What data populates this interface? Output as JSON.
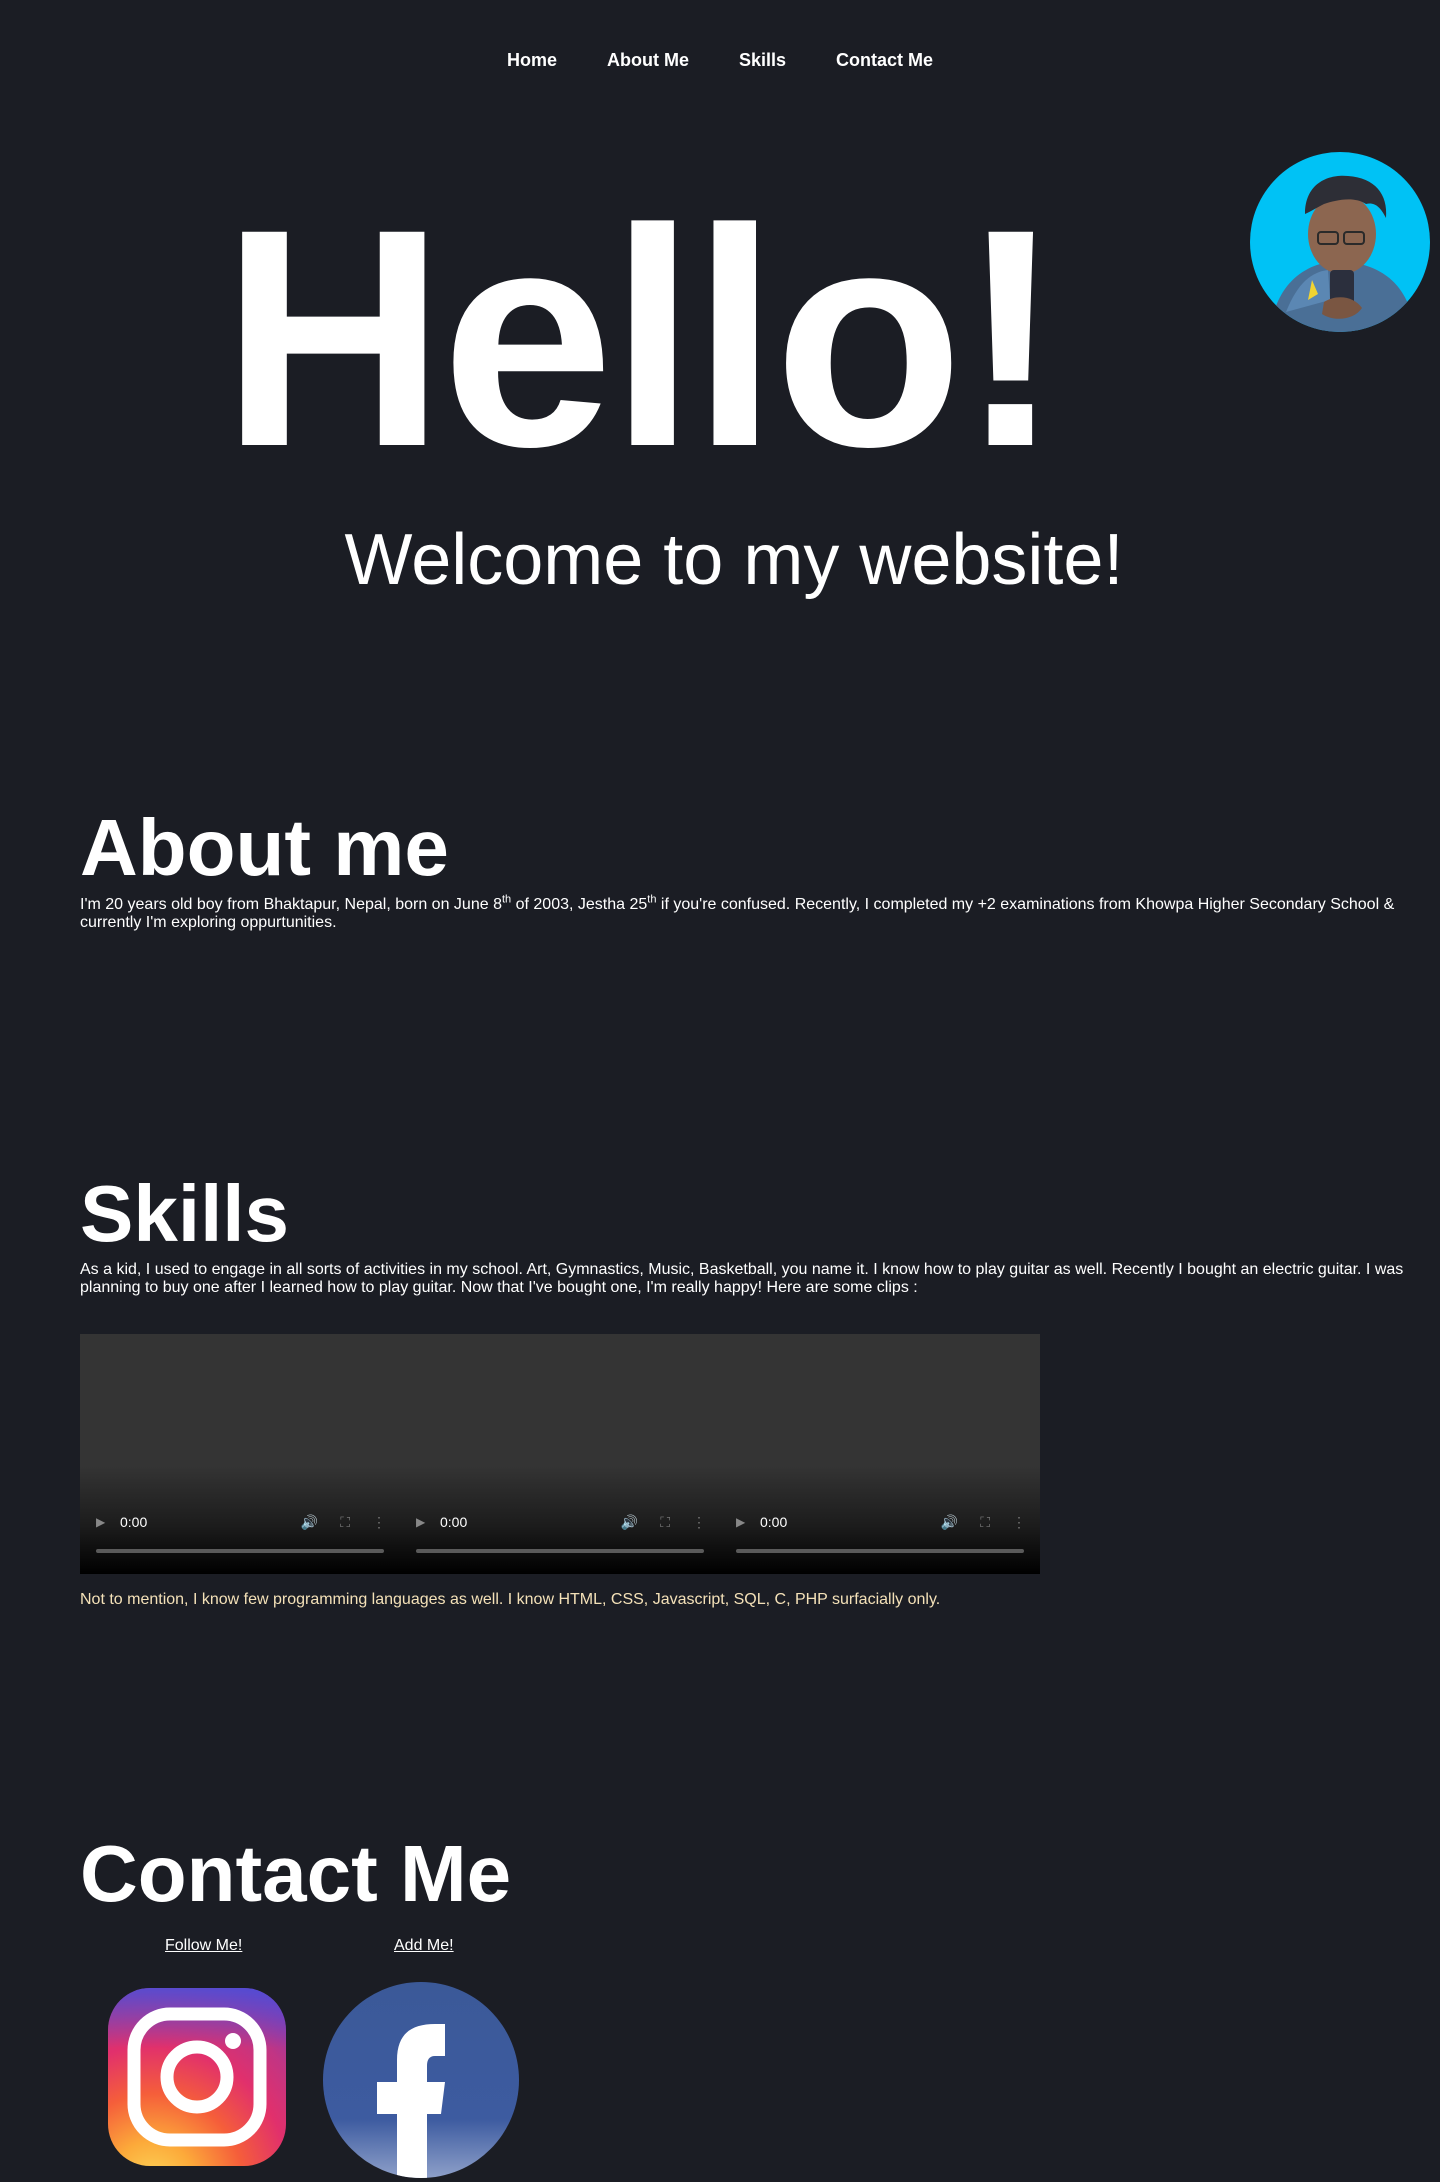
{
  "nav": {
    "items": [
      {
        "label": "Home"
      },
      {
        "label": "About Me"
      },
      {
        "label": "Skills"
      },
      {
        "label": "Contact Me"
      }
    ]
  },
  "hero": {
    "title": "Hello!",
    "subtitle": "Welcome to my website!"
  },
  "about": {
    "title": "About me",
    "text_1": "I'm 20 years old boy from Bhaktapur, Nepal, born on June 8",
    "sup_1": "th",
    "text_2": " of 2003, Jestha 25",
    "sup_2": "th",
    "text_3": " if you're confused. Recently, I completed my +2 examinations from Khowpa Higher Secondary School & currently I'm exploring oppurtunities."
  },
  "skills": {
    "title": "Skills",
    "text": "As a kid, I used to engage in all sorts of activities in my school. Art, Gymnastics, Music, Basketball, you name it. I know how to play guitar as well. Recently I bought an electric guitar. I was planning to buy one after I learned how to play guitar. Now that I've bought one, I'm really happy! Here are some clips :",
    "videos": [
      {
        "time": "0:00"
      },
      {
        "time": "0:00"
      },
      {
        "time": "0:00"
      }
    ],
    "programming_note": "Not to mention, I know few programming languages as well. I know HTML, CSS, Javascript, SQL, C, PHP surfacially only."
  },
  "contact": {
    "title": "Contact Me",
    "instagram_link": "Follow Me!",
    "facebook_link": "Add Me!"
  },
  "colors": {
    "background": "#1b1d24",
    "avatar_bg": "#00c2f5",
    "notice_text": "#f4e1b8",
    "facebook_blue": "#3b5998"
  }
}
